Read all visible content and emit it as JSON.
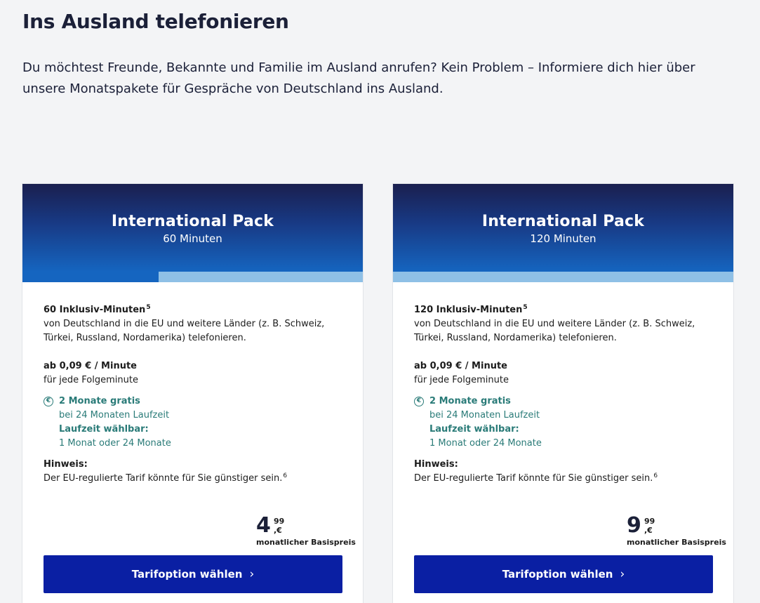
{
  "header": {
    "title": "Ins Ausland telefonieren",
    "intro": "Du möchtest Freunde, Bekannte und Familie im Ausland anrufen? Kein Problem – Informiere dich hier über unsere Monatspakete für Gespräche von Deutschland ins Ausland."
  },
  "colors": {
    "header_gradient_top": "#1a1f4f",
    "header_gradient_bottom": "#1565c0",
    "promo_teal": "#2a7b78",
    "cta_blue": "#0a1fa3"
  },
  "cards": [
    {
      "title": "International Pack",
      "subtitle": "60 Minuten",
      "progress_fraction": 0.4,
      "minutes_label": "60 Inklusiv-Minuten",
      "minutes_sup": "5",
      "minutes_desc": "von Deutschland in die EU und weitere Länder (z. B. Schweiz, Türkei, Russland, Nordamerika) telefonieren.",
      "rate_label": "ab 0,09 € / Minute",
      "rate_desc": "für jede Folgeminute",
      "promo_icon": "euro-circle-icon",
      "promo_title": "2 Monate gratis",
      "promo_desc": "bei 24 Monaten Laufzeit",
      "term_title": "Laufzeit wählbar:",
      "term_desc": "1 Monat oder 24 Monate",
      "note_title": "Hinweis:",
      "note_text": "Der EU-regulierte Tarif könnte für Sie günstiger sein.",
      "note_sup": "6",
      "price_int": "4",
      "price_cents": "99",
      "price_currency": ",€",
      "price_label": "monatlicher Basispreis",
      "cta_label": "Tarifoption wählen"
    },
    {
      "title": "International Pack",
      "subtitle": "120 Minuten",
      "progress_fraction": 0.0,
      "minutes_label": "120 Inklusiv-Minuten",
      "minutes_sup": "5",
      "minutes_desc": "von Deutschland in die EU und weitere Länder (z. B. Schweiz, Türkei, Russland, Nordamerika) telefonieren.",
      "rate_label": "ab 0,09 € / Minute",
      "rate_desc": "für jede Folgeminute",
      "promo_icon": "euro-circle-icon",
      "promo_title": "2 Monate gratis",
      "promo_desc": "bei 24 Monaten Laufzeit",
      "term_title": "Laufzeit wählbar:",
      "term_desc": "1 Monat oder 24 Monate",
      "note_title": "Hinweis:",
      "note_text": "Der EU-regulierte Tarif könnte für Sie günstiger sein.",
      "note_sup": "6",
      "price_int": "9",
      "price_cents": "99",
      "price_currency": ",€",
      "price_label": "monatlicher Basispreis",
      "cta_label": "Tarifoption wählen"
    }
  ]
}
